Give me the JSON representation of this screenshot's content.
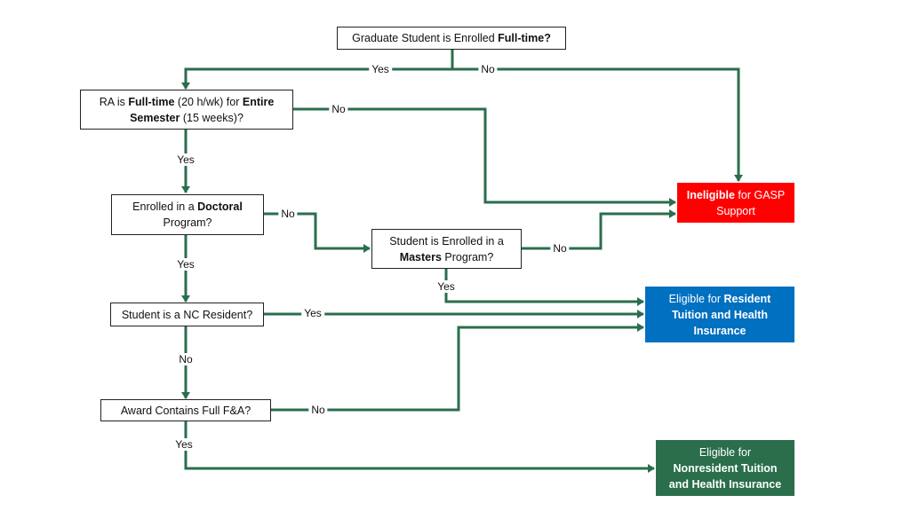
{
  "colors": {
    "connector": "#2a6e4c",
    "ineligible": "#ff0000",
    "resident": "#0070c0",
    "nonresident": "#2a6e4c"
  },
  "nodes": {
    "q1": {
      "pre": "Graduate Student is Enrolled ",
      "bold": "Full-time?",
      "post": ""
    },
    "q2": {
      "l1a": "RA is ",
      "l1b": "Full-time",
      "l1c": " (20 h/wk) for ",
      "l1d": "Entire",
      "l2a": "Semester",
      "l2b": " (15 weeks)?"
    },
    "q3": {
      "l1a": "Enrolled in a ",
      "l1b": "Doctoral",
      "l2": "Program?"
    },
    "q4": {
      "l1": "Student is Enrolled in a",
      "l2a": "Masters",
      "l2b": " Program?"
    },
    "q5": {
      "text": "Student is a NC Resident?"
    },
    "q6": {
      "text": "Award Contains Full F&A?"
    },
    "o1": {
      "bold": "Ineligible",
      "rest": " for GASP",
      "l2": "Support"
    },
    "o2": {
      "l1a": "Eligible for ",
      "l1b": "Resident",
      "l2": "Tuition and Health",
      "l3": "Insurance"
    },
    "o3": {
      "l1": "Eligible for",
      "l2": "Nonresident Tuition",
      "l3": "and Health Insurance"
    }
  },
  "edge_labels": {
    "q1_yes": "Yes",
    "q1_no": "No",
    "q2_no": "No",
    "q2_yes": "Yes",
    "q3_no": "No",
    "q3_yes": "Yes",
    "q4_no": "No",
    "q4_yes": "Yes",
    "q5_yes": "Yes",
    "q5_no": "No",
    "q6_no": "No",
    "q6_yes": "Yes"
  }
}
